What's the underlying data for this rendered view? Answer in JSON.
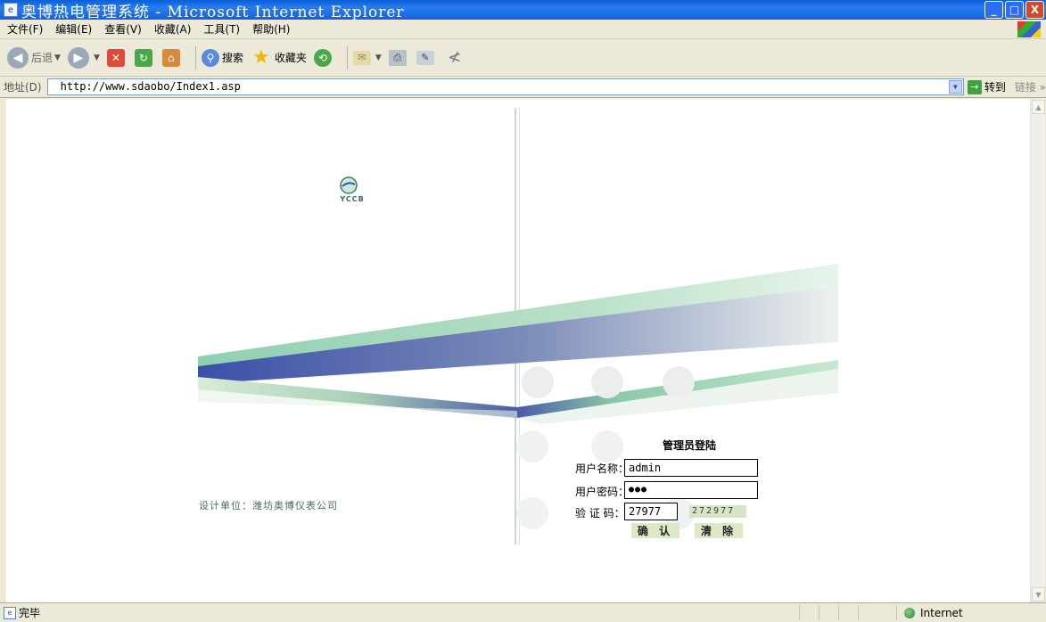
{
  "window": {
    "title": "奥博热电管理系统 - Microsoft Internet Explorer",
    "minimize": "_",
    "maximize": "□",
    "close": "X"
  },
  "menu": {
    "items": [
      "文件(F)",
      "编辑(E)",
      "查看(V)",
      "收藏(A)",
      "工具(T)",
      "帮助(H)"
    ]
  },
  "toolbar": {
    "back": "后退",
    "search": "搜索",
    "favorites": "收藏夹"
  },
  "address": {
    "label": "地址(D)",
    "url": "http://www.sdaobo/Index1.asp",
    "go": "转到",
    "links": "链接 »"
  },
  "page": {
    "logo_text": "YCCB",
    "designer": "设计单位：潍坊奥博仪表公司",
    "login": {
      "title": "管理员登陆",
      "username_label": "用户名称：",
      "username_value": "admin",
      "password_label": "用户密码：",
      "password_value": "●●●",
      "code_label": "验 证 码：",
      "code_value": "27977",
      "captcha": "272977",
      "confirm": "确 认",
      "clear": "清 除"
    }
  },
  "status": {
    "text": "完毕",
    "zone": "Internet"
  },
  "colors": {
    "accent_green": "#7fc8a0",
    "accent_blue": "#3a4fa8",
    "button_bg": "#dbe8c4"
  }
}
